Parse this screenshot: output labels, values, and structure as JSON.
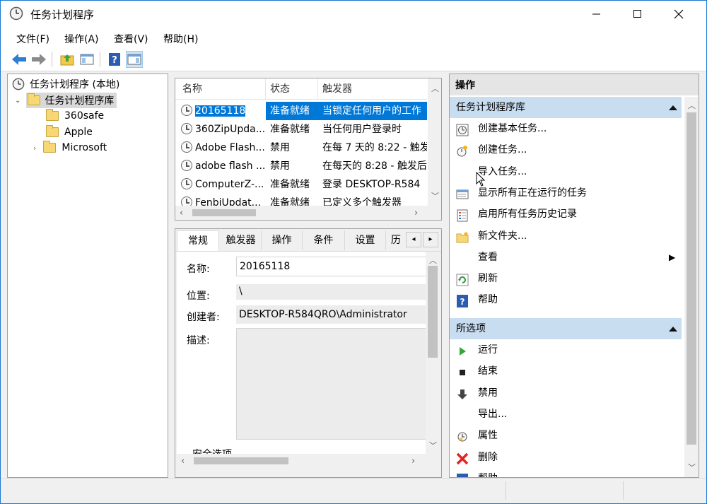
{
  "window": {
    "title": "任务计划程序"
  },
  "menu": [
    "文件(F)",
    "操作(A)",
    "查看(V)",
    "帮助(H)"
  ],
  "tree": {
    "root": "任务计划程序 (本地)",
    "library": "任务计划程序库",
    "children": [
      "360safe",
      "Apple",
      "Microsoft"
    ]
  },
  "task_list": {
    "columns": [
      "名称",
      "状态",
      "触发器"
    ],
    "rows": [
      {
        "name": "20165118",
        "status": "准备就绪",
        "trigger": "当锁定任何用户的工作"
      },
      {
        "name": "360ZipUpda...",
        "status": "准备就绪",
        "trigger": "当任何用户登录时"
      },
      {
        "name": "Adobe Flash...",
        "status": "禁用",
        "trigger": "在每 7 天的 8:22 - 触发"
      },
      {
        "name": "adobe flash ...",
        "status": "禁用",
        "trigger": "在每天的 8:28 - 触发后"
      },
      {
        "name": "ComputerZ-...",
        "status": "准备就绪",
        "trigger": "登录 DESKTOP-R584"
      },
      {
        "name": "FenbiUpdat...",
        "status": "准备就绪",
        "trigger": "已定义多个触发器"
      }
    ]
  },
  "detail": {
    "tabs": [
      "常规",
      "触发器",
      "操作",
      "条件",
      "设置",
      "历"
    ],
    "name_label": "名称:",
    "name_value": "20165118",
    "location_label": "位置:",
    "location_value": "\\",
    "author_label": "创建者:",
    "author_value": "DESKTOP-R584QRO\\Administrator",
    "desc_label": "描述:",
    "security_label": "安全选项"
  },
  "actions": {
    "header": "操作",
    "section1": {
      "title": "任务计划程序库",
      "items": [
        {
          "label": "创建基本任务...",
          "icon": "create-basic-task-icon"
        },
        {
          "label": "创建任务...",
          "icon": "create-task-icon"
        },
        {
          "label": "导入任务...",
          "icon": ""
        },
        {
          "label": "显示所有正在运行的任务",
          "icon": "running-tasks-icon"
        },
        {
          "label": "启用所有任务历史记录",
          "icon": "history-icon"
        },
        {
          "label": "新文件夹...",
          "icon": "folder-icon"
        },
        {
          "label": "查看",
          "icon": ""
        },
        {
          "label": "刷新",
          "icon": "refresh-icon"
        },
        {
          "label": "帮助",
          "icon": "help-icon"
        }
      ]
    },
    "section2": {
      "title": "所选项",
      "items": [
        {
          "label": "运行",
          "icon": "run-icon"
        },
        {
          "label": "结束",
          "icon": "stop-icon"
        },
        {
          "label": "禁用",
          "icon": "disable-icon"
        },
        {
          "label": "导出...",
          "icon": ""
        },
        {
          "label": "属性",
          "icon": "properties-icon"
        },
        {
          "label": "删除",
          "icon": "delete-icon"
        },
        {
          "label": "帮助",
          "icon": "help-icon"
        }
      ]
    }
  },
  "colors": {
    "selection": "#0078d7",
    "section_header": "#c9ddf1"
  }
}
